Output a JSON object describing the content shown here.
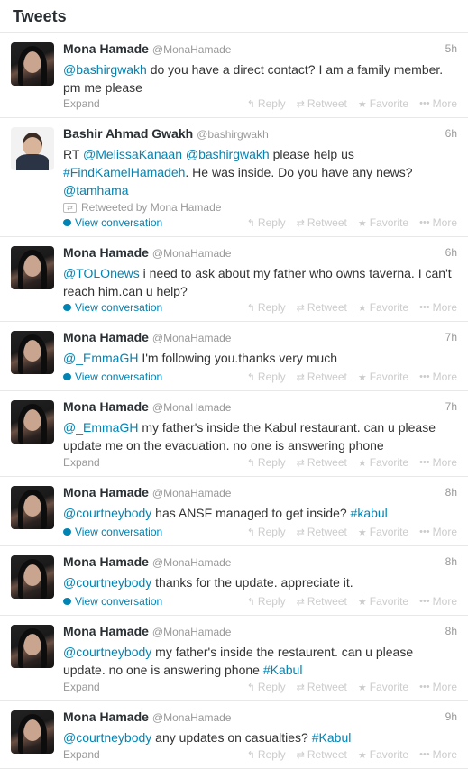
{
  "header": {
    "title": "Tweets"
  },
  "actions": {
    "reply": "Reply",
    "retweet": "Retweet",
    "favorite": "Favorite",
    "more": "More"
  },
  "tweets": [
    {
      "name": "Mona Hamade",
      "handle": "@MonaHamade",
      "time": "5h",
      "avatar": "mona",
      "parts": [
        {
          "t": "@bashirgwakh",
          "l": true
        },
        {
          "t": " do you have a direct contact? I am a family member. pm me please",
          "l": false
        }
      ],
      "footer_label": "Expand",
      "footer_type": "expand"
    },
    {
      "name": "Bashir Ahmad Gwakh",
      "handle": "@bashirgwakh",
      "time": "6h",
      "avatar": "bashir",
      "parts": [
        {
          "t": "RT ",
          "l": false
        },
        {
          "t": "@MelissaKanaan",
          "l": true
        },
        {
          "t": " ",
          "l": false
        },
        {
          "t": "@bashirgwakh",
          "l": true
        },
        {
          "t": " please help us ",
          "l": false
        },
        {
          "t": "#FindKamelHamadeh",
          "l": true
        },
        {
          "t": ". He was inside. Do you have any news? ",
          "l": false
        },
        {
          "t": "@tamhama",
          "l": true
        }
      ],
      "retweeted_by": "Retweeted by Mona Hamade",
      "footer_label": "View conversation",
      "footer_type": "conv"
    },
    {
      "name": "Mona Hamade",
      "handle": "@MonaHamade",
      "time": "6h",
      "avatar": "mona",
      "parts": [
        {
          "t": "@TOLOnews",
          "l": true
        },
        {
          "t": "  i need to ask about my father who owns taverna. I can't reach him.can u help?",
          "l": false
        }
      ],
      "footer_label": "View conversation",
      "footer_type": "conv"
    },
    {
      "name": "Mona Hamade",
      "handle": "@MonaHamade",
      "time": "7h",
      "avatar": "mona",
      "parts": [
        {
          "t": "@_EmmaGH",
          "l": true
        },
        {
          "t": " I'm following you.thanks very much",
          "l": false
        }
      ],
      "footer_label": "View conversation",
      "footer_type": "conv"
    },
    {
      "name": "Mona Hamade",
      "handle": "@MonaHamade",
      "time": "7h",
      "avatar": "mona",
      "parts": [
        {
          "t": "@_EmmaGH",
          "l": true
        },
        {
          "t": "  my father's inside the Kabul restaurant. can u please update me on the evacuation. no one is answering phone",
          "l": false
        }
      ],
      "footer_label": "Expand",
      "footer_type": "expand"
    },
    {
      "name": "Mona Hamade",
      "handle": "@MonaHamade",
      "time": "8h",
      "avatar": "mona",
      "parts": [
        {
          "t": "@courtneybody",
          "l": true
        },
        {
          "t": "  has ANSF managed to get inside? ",
          "l": false
        },
        {
          "t": "#kabul",
          "l": true
        }
      ],
      "footer_label": "View conversation",
      "footer_type": "conv"
    },
    {
      "name": "Mona Hamade",
      "handle": "@MonaHamade",
      "time": "8h",
      "avatar": "mona",
      "parts": [
        {
          "t": "@courtneybody",
          "l": true
        },
        {
          "t": "  thanks for the update. appreciate it.",
          "l": false
        }
      ],
      "footer_label": "View conversation",
      "footer_type": "conv"
    },
    {
      "name": "Mona Hamade",
      "handle": "@MonaHamade",
      "time": "8h",
      "avatar": "mona",
      "parts": [
        {
          "t": "@courtneybody",
          "l": true
        },
        {
          "t": " my father's inside the restaurent. can u please update. no one is answering phone ",
          "l": false
        },
        {
          "t": "#Kabul",
          "l": true
        }
      ],
      "footer_label": "Expand",
      "footer_type": "expand"
    },
    {
      "name": "Mona Hamade",
      "handle": "@MonaHamade",
      "time": "9h",
      "avatar": "mona",
      "parts": [
        {
          "t": "@courtneybody",
          "l": true
        },
        {
          "t": " any updates on casualties? ",
          "l": false
        },
        {
          "t": "#Kabul",
          "l": true
        }
      ],
      "footer_label": "Expand",
      "footer_type": "expand"
    }
  ]
}
